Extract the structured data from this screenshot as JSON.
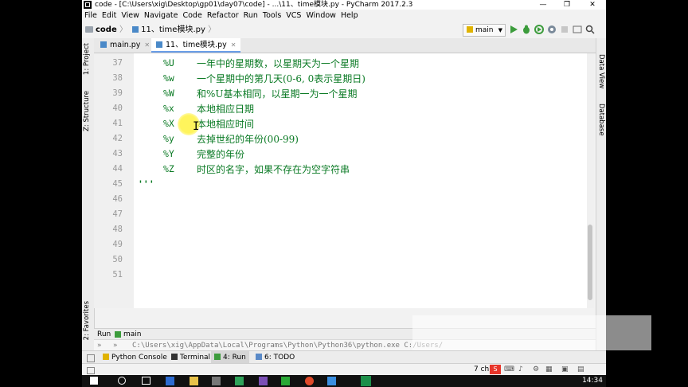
{
  "titlebar": {
    "text": "code - [C:\\Users\\xig\\Desktop\\gp01\\day07\\code] - ...\\11、time模块.py - PyCharm 2017.2.3",
    "minimize": "—",
    "maximize": "❐",
    "close": "✕"
  },
  "menu": [
    "File",
    "Edit",
    "View",
    "Navigate",
    "Code",
    "Refactor",
    "Run",
    "Tools",
    "VCS",
    "Window",
    "Help"
  ],
  "navbar": {
    "breadcrumb_project": "code",
    "breadcrumb_file": "11、time模块.py",
    "run_config": "main",
    "icons": [
      "run-icon",
      "debug-icon",
      "coverage-icon",
      "profile-icon",
      "stop-icon",
      "search-icon"
    ]
  },
  "tabs": [
    {
      "label": "main.py",
      "active": false
    },
    {
      "label": "11、time模块.py",
      "active": true
    }
  ],
  "left_tool_strip": {
    "project": "1: Project",
    "structure": "Z: Structure",
    "favorites": "2: Favorites"
  },
  "right_tool_strip": {
    "data_view": "Data View",
    "database": "Database"
  },
  "editor": {
    "line_numbers": [
      "37",
      "38",
      "39",
      "40",
      "41",
      "42",
      "43",
      "44",
      "45",
      "46",
      "47",
      "48",
      "49",
      "50",
      "51"
    ],
    "lines": [
      {
        "code": "%U",
        "desc": "一年中的星期数，以星期天为一个星期"
      },
      {
        "code": "%w",
        "desc": "一个星期中的第几天(0-6, 0表示星期日)"
      },
      {
        "code": "%W",
        "desc": "和%U基本相同，以星期一为一个星期"
      },
      {
        "code": "%x",
        "desc": "本地相应日期"
      },
      {
        "code": "%X",
        "desc": "本地相应时间"
      },
      {
        "code": "%y",
        "desc": "去掉世纪的年份(00-99)"
      },
      {
        "code": "%Y",
        "desc": "完整的年份"
      },
      {
        "code": "%Z",
        "desc": "时区的名字，如果不存在为空字符串"
      }
    ],
    "closing_quotes": "'''"
  },
  "run_panel": {
    "label": "Run",
    "tab": "main",
    "output": "C:\\Users\\xig\\AppData\\Local\\Programs\\Python\\Python36\\python.exe C:/Users/"
  },
  "tool_windows": [
    {
      "label": "Python Console",
      "active": false
    },
    {
      "label": "Terminal",
      "active": false
    },
    {
      "label": "4: Run",
      "active": true
    },
    {
      "label": "6: TODO",
      "active": false
    }
  ],
  "statusbar": {
    "right": "7 ch"
  },
  "taskbar": {
    "time": "14:34"
  },
  "colors": {
    "code_green": "#0a7a24",
    "accent_blue": "#6a9ee8",
    "run_green": "#3c9c3c"
  }
}
